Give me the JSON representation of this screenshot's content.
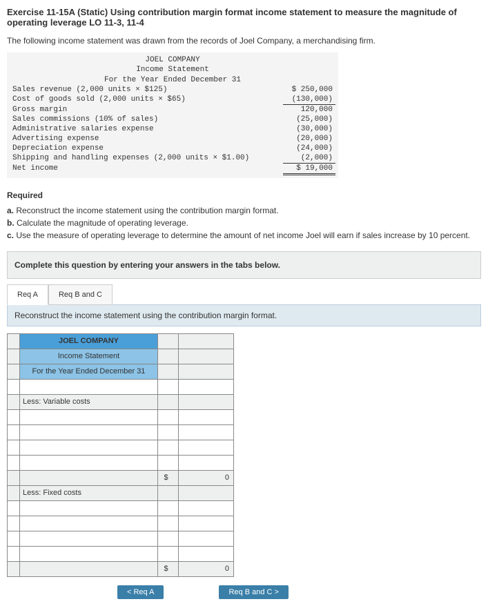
{
  "title": "Exercise 11-15A (Static) Using contribution margin format income statement to measure the magnitude of operating leverage LO 11-3, 11-4",
  "intro": "The following income statement was drawn from the records of Joel Company, a merchandising firm.",
  "stmt": {
    "company": "JOEL COMPANY",
    "name": "Income Statement",
    "period": "For the Year Ended December 31",
    "rows": [
      {
        "label": "Sales revenue (2,000 units × $125)",
        "value": "$ 250,000"
      },
      {
        "label": "Cost of goods sold (2,000 units × $65)",
        "value": "(130,000)"
      },
      {
        "label": "Gross margin",
        "value": "120,000"
      },
      {
        "label": "Sales commissions (10% of sales)",
        "value": "(25,000)"
      },
      {
        "label": "Administrative salaries expense",
        "value": "(30,000)"
      },
      {
        "label": "Advertising expense",
        "value": "(20,000)"
      },
      {
        "label": "Depreciation expense",
        "value": "(24,000)"
      },
      {
        "label": "Shipping and handling expenses (2,000 units × $1.00)",
        "value": "(2,000)"
      },
      {
        "label": "Net income",
        "value": "$  19,000"
      }
    ]
  },
  "requiredHead": "Required",
  "required": {
    "a": "Reconstruct the income statement using the contribution margin format.",
    "b": "Calculate the magnitude of operating leverage.",
    "c": "Use the measure of operating leverage to determine the amount of net income Joel will earn if sales increase by 10 percent."
  },
  "instruct": "Complete this question by entering your answers in the tabs below.",
  "tabs": {
    "a": "Req A",
    "bc": "Req B and C"
  },
  "tabDesc": "Reconstruct the income statement using the contribution margin format.",
  "answer": {
    "company": "JOEL COMPANY",
    "name": "Income Statement",
    "period": "For the Year Ended December 31",
    "lessVar": "Less: Variable costs",
    "lessFix": "Less: Fixed costs",
    "sym": "$",
    "zero": "0"
  },
  "nav": {
    "prev": "< Req A",
    "next": "Req B and C >"
  }
}
